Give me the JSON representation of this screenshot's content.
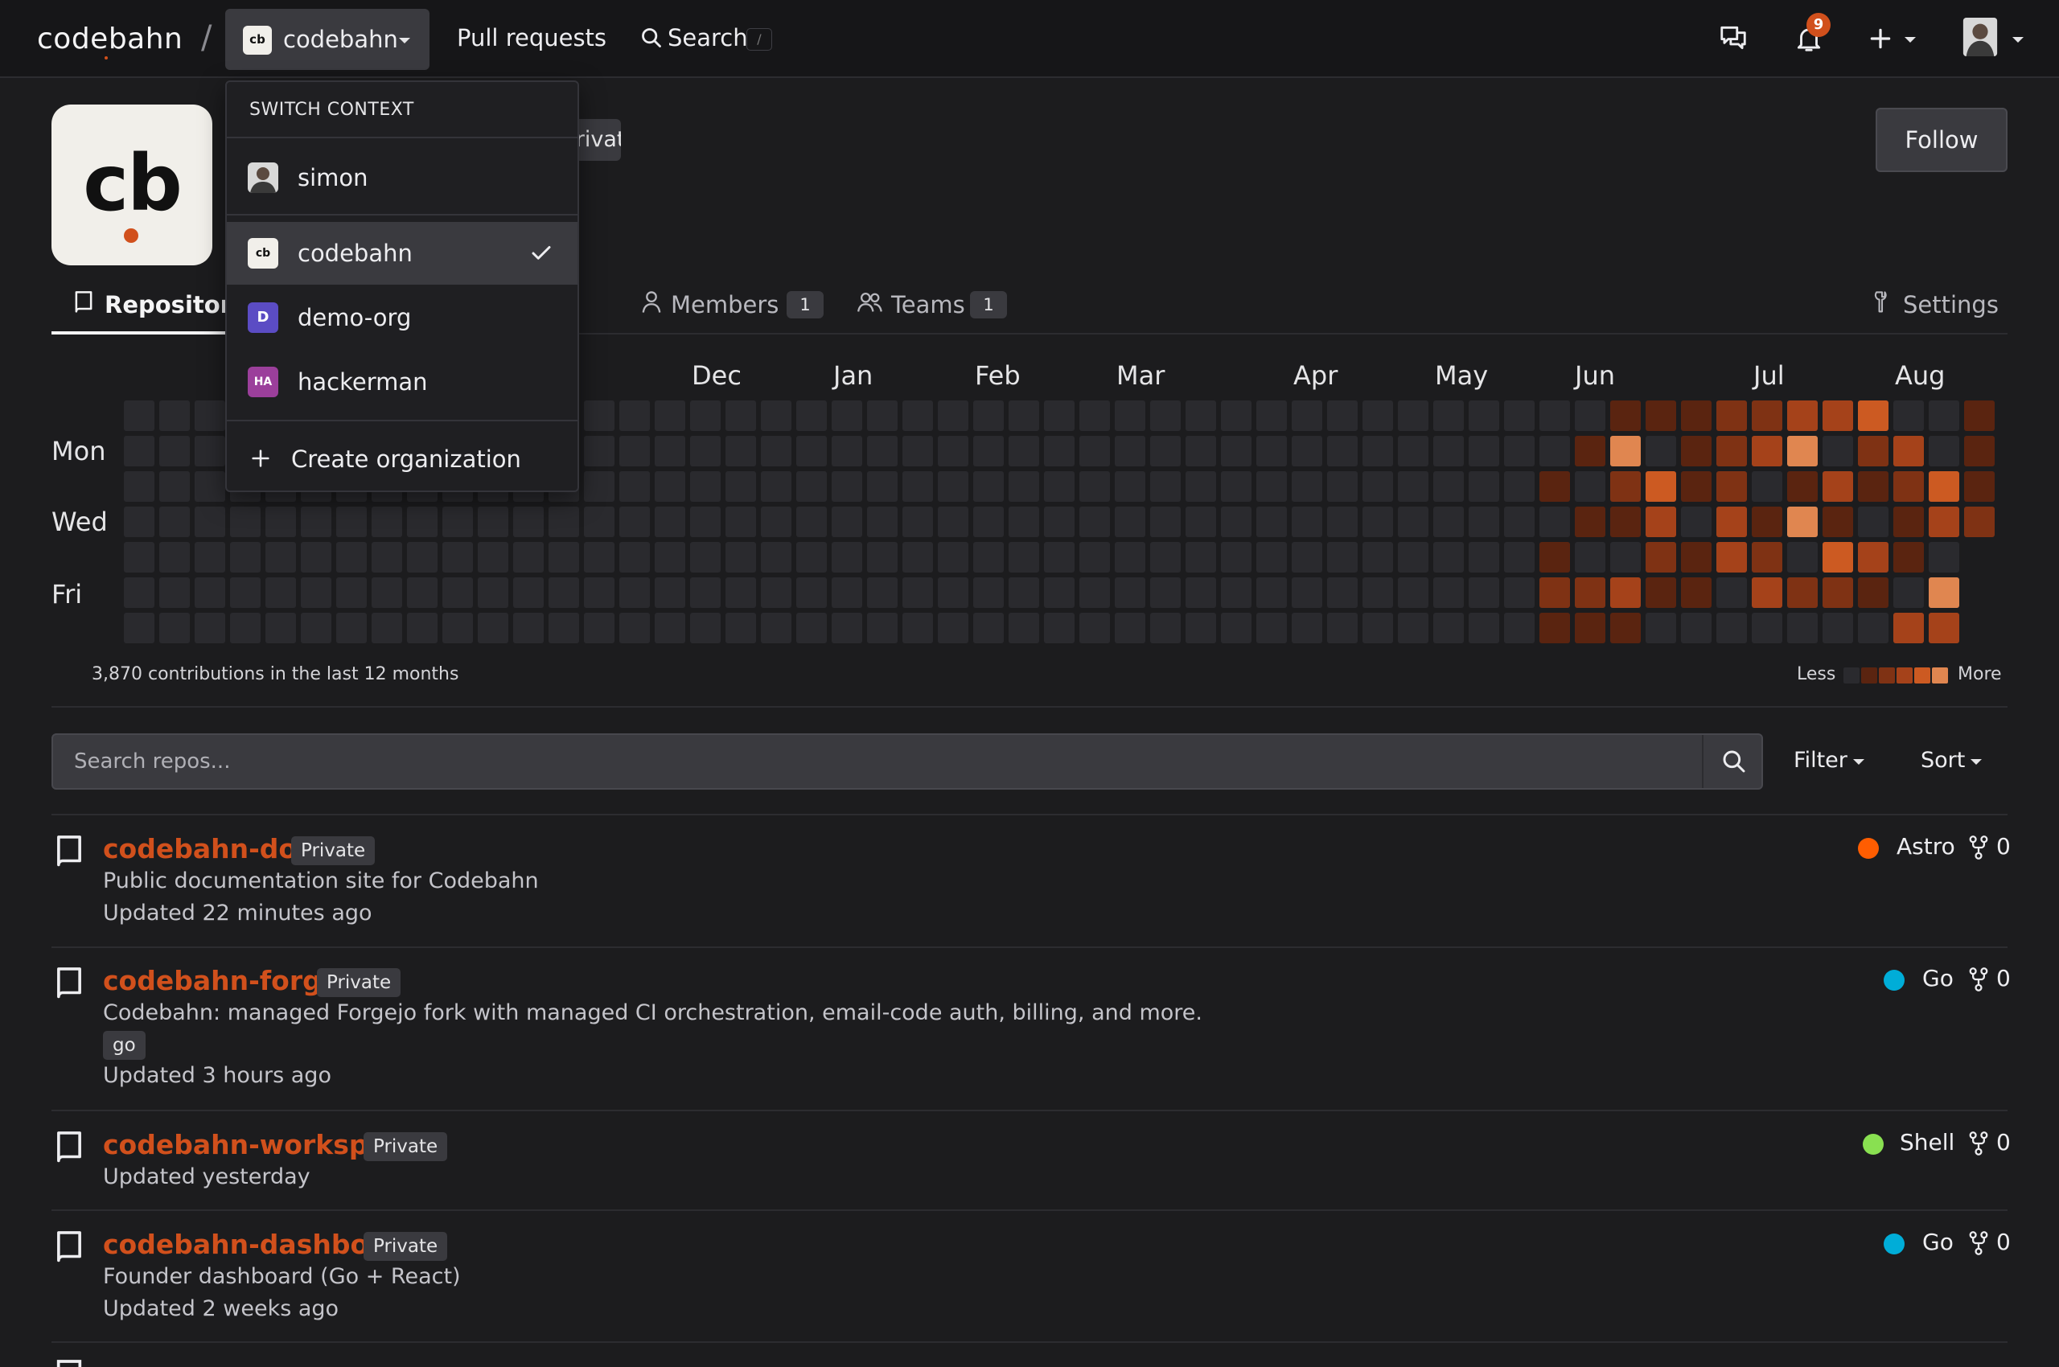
{
  "nav": {
    "brand": "codebahn",
    "separator": "/",
    "context": {
      "logo_text": "cb",
      "label": "codebahn"
    },
    "pull_requests": "Pull requests",
    "search": "Search",
    "search_shortcut": "/",
    "notification_count": "9"
  },
  "org": {
    "logo_text": "cb",
    "private_chip": "Private",
    "follow": "Follow"
  },
  "tabs": {
    "repositories": "Repositories",
    "members": "Members",
    "members_count": "1",
    "teams": "Teams",
    "teams_count": "1",
    "settings": "Settings"
  },
  "heatmap": {
    "months": [
      "Dec",
      "Jan",
      "Feb",
      "Mar",
      "Apr",
      "May",
      "Jun",
      "Jul",
      "Aug"
    ],
    "days": [
      "Mon",
      "Wed",
      "Fri"
    ],
    "contributions": "3,870 contributions in the last 12 months",
    "legend_less": "Less",
    "legend_more": "More",
    "colors": [
      "#2a2a2e",
      "#5a2410",
      "#7f3214",
      "#a5421a",
      "#cc5a22",
      "#e08650"
    ]
  },
  "search": {
    "placeholder": "Search repos..."
  },
  "filter": "Filter",
  "sort": "Sort",
  "repos": [
    {
      "name": "codebahn-docs",
      "badge": "Private",
      "description": "Public documentation site for Codebahn",
      "topic": "",
      "updated": "Updated 22 minutes ago",
      "language": "Astro",
      "lang_color": "#ff5d01",
      "forks": "0"
    },
    {
      "name": "codebahn-forgejo",
      "badge": "Private",
      "description": "Codebahn: managed Forgejo fork with managed CI orchestration, email-code auth, billing, and more.",
      "topic": "go",
      "updated": "Updated 3 hours ago",
      "language": "Go",
      "lang_color": "#00add8",
      "forks": "0"
    },
    {
      "name": "codebahn-workspace",
      "badge": "Private",
      "description": "",
      "topic": "",
      "updated": "Updated yesterday",
      "language": "Shell",
      "lang_color": "#89e051",
      "forks": "0"
    },
    {
      "name": "codebahn-dashboard",
      "badge": "Private",
      "description": "Founder dashboard (Go + React)",
      "topic": "",
      "updated": "Updated 2 weeks ago",
      "language": "Go",
      "lang_color": "#00add8",
      "forks": "0"
    }
  ],
  "menu": {
    "header": "SWITCH CONTEXT",
    "items": [
      {
        "label": "simon",
        "icon_text": ""
      },
      {
        "label": "codebahn",
        "icon_text": "cb"
      },
      {
        "label": "demo-org",
        "icon_text": "D"
      },
      {
        "label": "hackerman",
        "icon_text": "HA"
      }
    ],
    "create": "Create organization"
  }
}
